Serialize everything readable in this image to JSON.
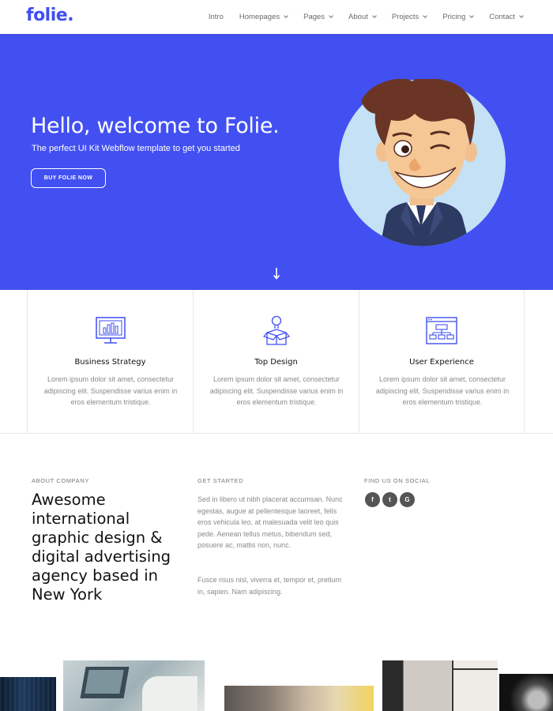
{
  "brand": {
    "logo": "folie.",
    "accent": "#3f4ff0",
    "hero_bg": "#4250f2"
  },
  "nav": {
    "items": [
      {
        "label": "Intro",
        "dropdown": false
      },
      {
        "label": "Homepages",
        "dropdown": true
      },
      {
        "label": "Pages",
        "dropdown": true
      },
      {
        "label": "About",
        "dropdown": true
      },
      {
        "label": "Projects",
        "dropdown": true
      },
      {
        "label": "Pricing",
        "dropdown": true
      },
      {
        "label": "Contact",
        "dropdown": true
      }
    ]
  },
  "hero": {
    "title": "Hello, welcome to Folie.",
    "subtitle": "The perfect UI Kit Webflow template to get you started",
    "button_label": "BUY FOLIE NOW",
    "scroll_icon": "arrow-down-icon"
  },
  "features": [
    {
      "icon": "chart-monitor-icon",
      "title": "Business Strategy",
      "text": "Lorem ipsum dolor sit amet, consectetur adipiscing elit. Suspendisse varius enim in eros elementum tristique."
    },
    {
      "icon": "lightbulb-box-icon",
      "title": "Top Design",
      "text": "Lorem ipsum dolor sit amet, consectetur adipiscing elit. Suspendisse varius enim in eros elementum tristique."
    },
    {
      "icon": "sitemap-window-icon",
      "title": "User Experience",
      "text": "Lorem ipsum dolor sit amet, consectetur adipiscing elit. Suspendisse varius enim in eros elementum tristique."
    }
  ],
  "about": {
    "label": "ABOUT COMPANY",
    "heading": "Awesome international graphic design & digital advertising agency based in New York"
  },
  "started": {
    "label": "GET STARTED",
    "paragraph1": "Sed in libero ut nibh placerat accumsan. Nunc egestas, augue at pellentesque laoreet, felis eros vehicula leo, at malesuada velit leo quis pede. Aenean tellus metus, bibendum sed, posuere ac, mattis non, nunc.",
    "paragraph2": "Fusce risus nisl, viverra et, tempor et, pretium in, sapien. Nam adipiscing."
  },
  "social": {
    "label": "FIND US ON SOCIAL",
    "links": [
      {
        "icon": "facebook-icon",
        "glyph": "f"
      },
      {
        "icon": "twitter-icon",
        "glyph": "t"
      },
      {
        "icon": "google-icon",
        "glyph": "G"
      }
    ]
  }
}
